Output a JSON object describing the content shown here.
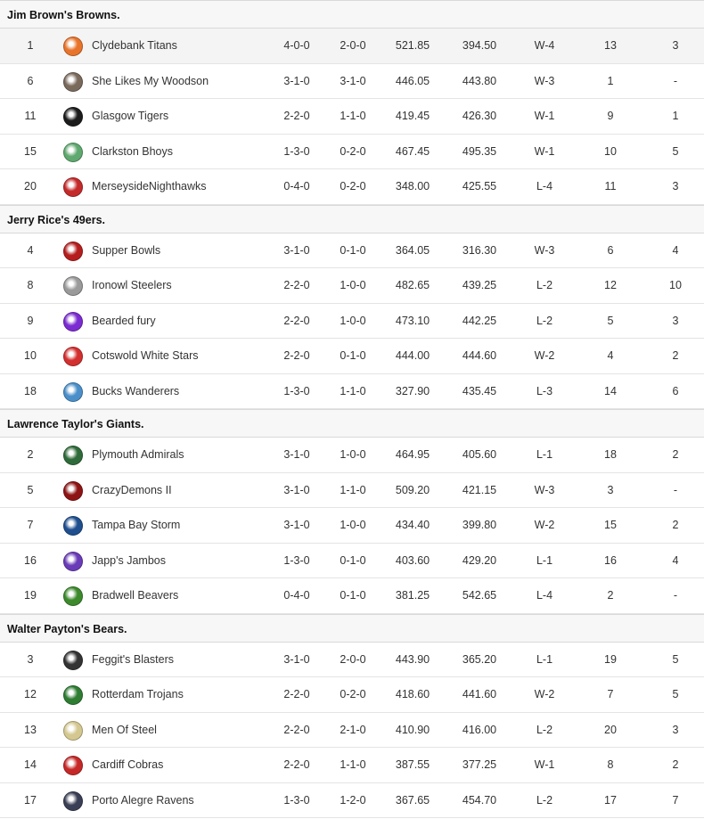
{
  "colors": {
    "header_bg": "#f7f7f7",
    "highlight_row_bg": "#f4f4f4",
    "row_border": "#e4e4e4",
    "text": "#333333"
  },
  "divisions": [
    {
      "name": "Jim Brown's Browns.",
      "teams": [
        {
          "rank": "1",
          "name": "Clydebank Titans",
          "record": "4-0-0",
          "div_record": "2-0-0",
          "pf": "521.85",
          "pa": "394.50",
          "streak": "W-4",
          "col9": "13",
          "col10": "3",
          "logo_icon": "titans-helmet-icon",
          "logo_color": "#e8742b"
        },
        {
          "rank": "6",
          "name": "She Likes My Woodson",
          "record": "3-1-0",
          "div_record": "3-1-0",
          "pf": "446.05",
          "pa": "443.80",
          "streak": "W-3",
          "col9": "1",
          "col10": "-",
          "logo_icon": "avatar-photo-icon",
          "logo_color": "#7a6a5c"
        },
        {
          "rank": "11",
          "name": "Glasgow Tigers",
          "record": "2-2-0",
          "div_record": "1-1-0",
          "pf": "419.45",
          "pa": "426.30",
          "streak": "W-1",
          "col9": "9",
          "col10": "1",
          "logo_icon": "tiger-icon",
          "logo_color": "#1c1c1c"
        },
        {
          "rank": "15",
          "name": "Clarkston Bhoys",
          "record": "1-3-0",
          "div_record": "0-2-0",
          "pf": "467.45",
          "pa": "495.35",
          "streak": "W-1",
          "col9": "10",
          "col10": "5",
          "logo_icon": "celtic-crest-icon",
          "logo_color": "#5fa86f"
        },
        {
          "rank": "20",
          "name": "MerseysideNighthawks",
          "record": "0-4-0",
          "div_record": "0-2-0",
          "pf": "348.00",
          "pa": "425.55",
          "streak": "L-4",
          "col9": "11",
          "col10": "3",
          "logo_icon": "red-helmet-icon",
          "logo_color": "#c42a2a"
        }
      ]
    },
    {
      "name": "Jerry Rice's 49ers.",
      "teams": [
        {
          "rank": "4",
          "name": "Supper Bowls",
          "record": "3-1-0",
          "div_record": "0-1-0",
          "pf": "364.05",
          "pa": "316.30",
          "streak": "W-3",
          "col9": "6",
          "col10": "4",
          "logo_icon": "red-black-logo-icon",
          "logo_color": "#b51e1e"
        },
        {
          "rank": "8",
          "name": "Ironowl Steelers",
          "record": "2-2-0",
          "div_record": "1-0-0",
          "pf": "482.65",
          "pa": "439.25",
          "streak": "L-2",
          "col9": "12",
          "col10": "10",
          "logo_icon": "steelers-logo-icon",
          "logo_color": "#9a9a9a"
        },
        {
          "rank": "9",
          "name": "Bearded fury",
          "record": "2-2-0",
          "div_record": "1-0-0",
          "pf": "473.10",
          "pa": "442.25",
          "streak": "L-2",
          "col9": "5",
          "col10": "3",
          "logo_icon": "purple-helmet-icon",
          "logo_color": "#7b2bd1"
        },
        {
          "rank": "10",
          "name": "Cotswold White Stars",
          "record": "2-2-0",
          "div_record": "0-1-0",
          "pf": "444.00",
          "pa": "444.60",
          "streak": "W-2",
          "col9": "4",
          "col10": "2",
          "logo_icon": "rooster-icon",
          "logo_color": "#d32f2f"
        },
        {
          "rank": "18",
          "name": "Bucks Wanderers",
          "record": "1-3-0",
          "div_record": "1-1-0",
          "pf": "327.90",
          "pa": "435.45",
          "streak": "L-3",
          "col9": "14",
          "col10": "6",
          "logo_icon": "blue-crest-icon",
          "logo_color": "#4a8fc9"
        }
      ]
    },
    {
      "name": "Lawrence Taylor's Giants.",
      "teams": [
        {
          "rank": "2",
          "name": "Plymouth Admirals",
          "record": "3-1-0",
          "div_record": "1-0-0",
          "pf": "464.95",
          "pa": "405.60",
          "streak": "L-1",
          "col9": "18",
          "col10": "2",
          "logo_icon": "admiral-hat-icon",
          "logo_color": "#2f6b3a"
        },
        {
          "rank": "5",
          "name": "CrazyDemons II",
          "record": "3-1-0",
          "div_record": "1-1-0",
          "pf": "509.20",
          "pa": "421.15",
          "streak": "W-3",
          "col9": "3",
          "col10": "-",
          "logo_icon": "demon-icon",
          "logo_color": "#8e1414"
        },
        {
          "rank": "7",
          "name": "Tampa Bay Storm",
          "record": "3-1-0",
          "div_record": "1-0-0",
          "pf": "434.40",
          "pa": "399.80",
          "streak": "W-2",
          "col9": "15",
          "col10": "2",
          "logo_icon": "storm-logo-icon",
          "logo_color": "#1f4f8f"
        },
        {
          "rank": "16",
          "name": "Japp's Jambos",
          "record": "1-3-0",
          "div_record": "0-1-0",
          "pf": "403.60",
          "pa": "429.20",
          "streak": "L-1",
          "col9": "16",
          "col10": "4",
          "logo_icon": "purple-gold-helmet-icon",
          "logo_color": "#6a3bb8"
        },
        {
          "rank": "19",
          "name": "Bradwell Beavers",
          "record": "0-4-0",
          "div_record": "0-1-0",
          "pf": "381.25",
          "pa": "542.65",
          "streak": "L-4",
          "col9": "2",
          "col10": "-",
          "logo_icon": "green-gold-helmet-icon",
          "logo_color": "#3c8a2c"
        }
      ]
    },
    {
      "name": "Walter Payton's Bears.",
      "teams": [
        {
          "rank": "3",
          "name": "Feggit's Blasters",
          "record": "3-1-0",
          "div_record": "2-0-0",
          "pf": "443.90",
          "pa": "365.20",
          "streak": "L-1",
          "col9": "19",
          "col10": "5",
          "logo_icon": "black-helmet-icon",
          "logo_color": "#333333"
        },
        {
          "rank": "12",
          "name": "Rotterdam Trojans",
          "record": "2-2-0",
          "div_record": "0-2-0",
          "pf": "418.60",
          "pa": "441.60",
          "streak": "W-2",
          "col9": "7",
          "col10": "5",
          "logo_icon": "trojan-helmet-icon",
          "logo_color": "#2e7d32"
        },
        {
          "rank": "13",
          "name": "Men Of Steel",
          "record": "2-2-0",
          "div_record": "2-1-0",
          "pf": "410.90",
          "pa": "416.00",
          "streak": "L-2",
          "col9": "20",
          "col10": "3",
          "logo_icon": "steel-helmet-icon",
          "logo_color": "#d4c890"
        },
        {
          "rank": "14",
          "name": "Cardiff Cobras",
          "record": "2-2-0",
          "div_record": "1-1-0",
          "pf": "387.55",
          "pa": "377.25",
          "streak": "W-1",
          "col9": "8",
          "col10": "2",
          "logo_icon": "cobra-icon",
          "logo_color": "#c62828"
        },
        {
          "rank": "17",
          "name": "Porto Alegre Ravens",
          "record": "1-3-0",
          "div_record": "1-2-0",
          "pf": "367.65",
          "pa": "454.70",
          "streak": "L-2",
          "col9": "17",
          "col10": "7",
          "logo_icon": "raven-helmet-icon",
          "logo_color": "#3a3f55"
        }
      ]
    }
  ]
}
